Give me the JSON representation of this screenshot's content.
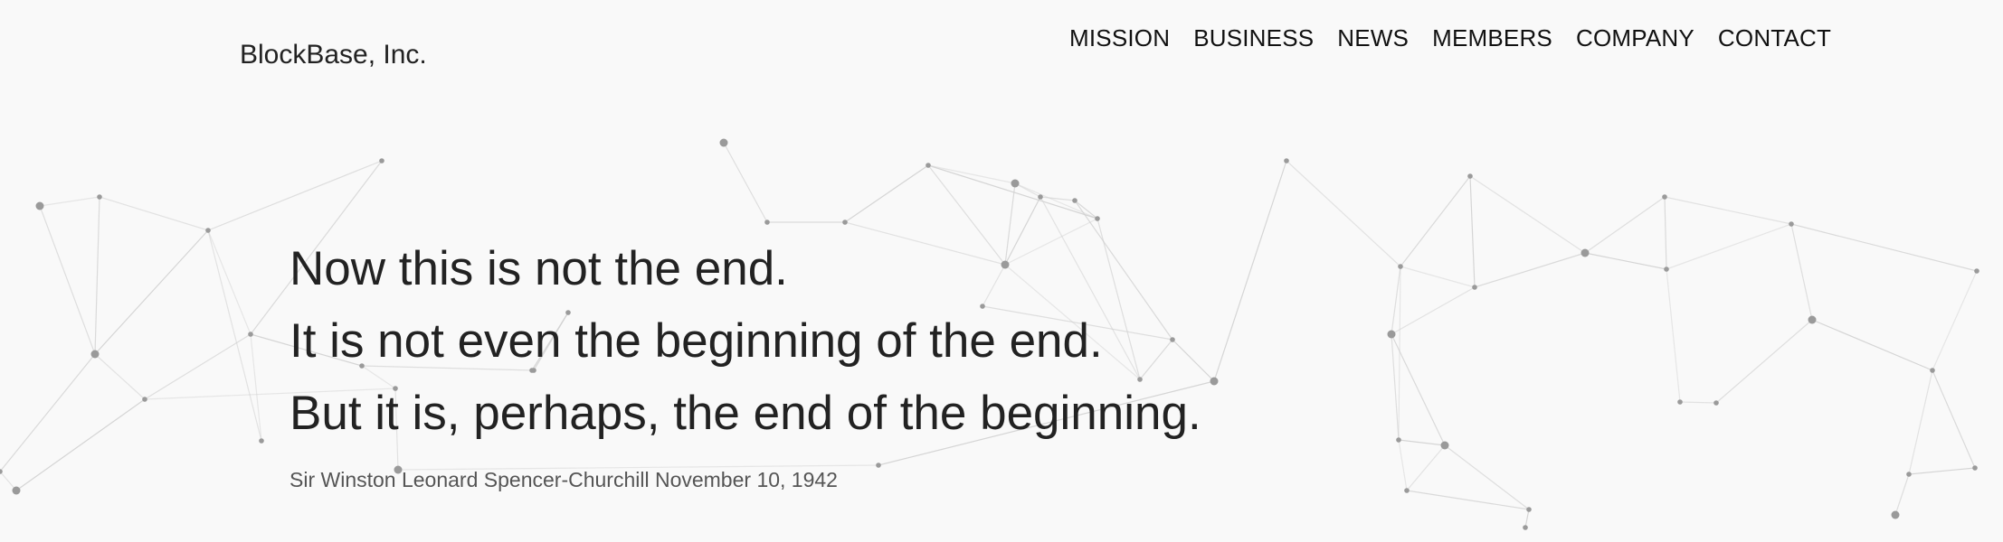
{
  "header": {
    "logo": "BlockBase, Inc.",
    "nav": [
      "MISSION",
      "BUSINESS",
      "NEWS",
      "MEMBERS",
      "COMPANY",
      "CONTACT"
    ]
  },
  "hero": {
    "quote_lines": [
      "Now this is not the end.",
      "It is not even the beginning of the end.",
      "But it is, perhaps, the end of the beginning."
    ],
    "attribution": "Sir Winston Leonard Spencer-Churchill November 10, 1942"
  },
  "colors": {
    "background": "#f9f9f9",
    "text": "#222222",
    "network_node": "#9a9a9a",
    "network_line": "#cfcfcf"
  }
}
